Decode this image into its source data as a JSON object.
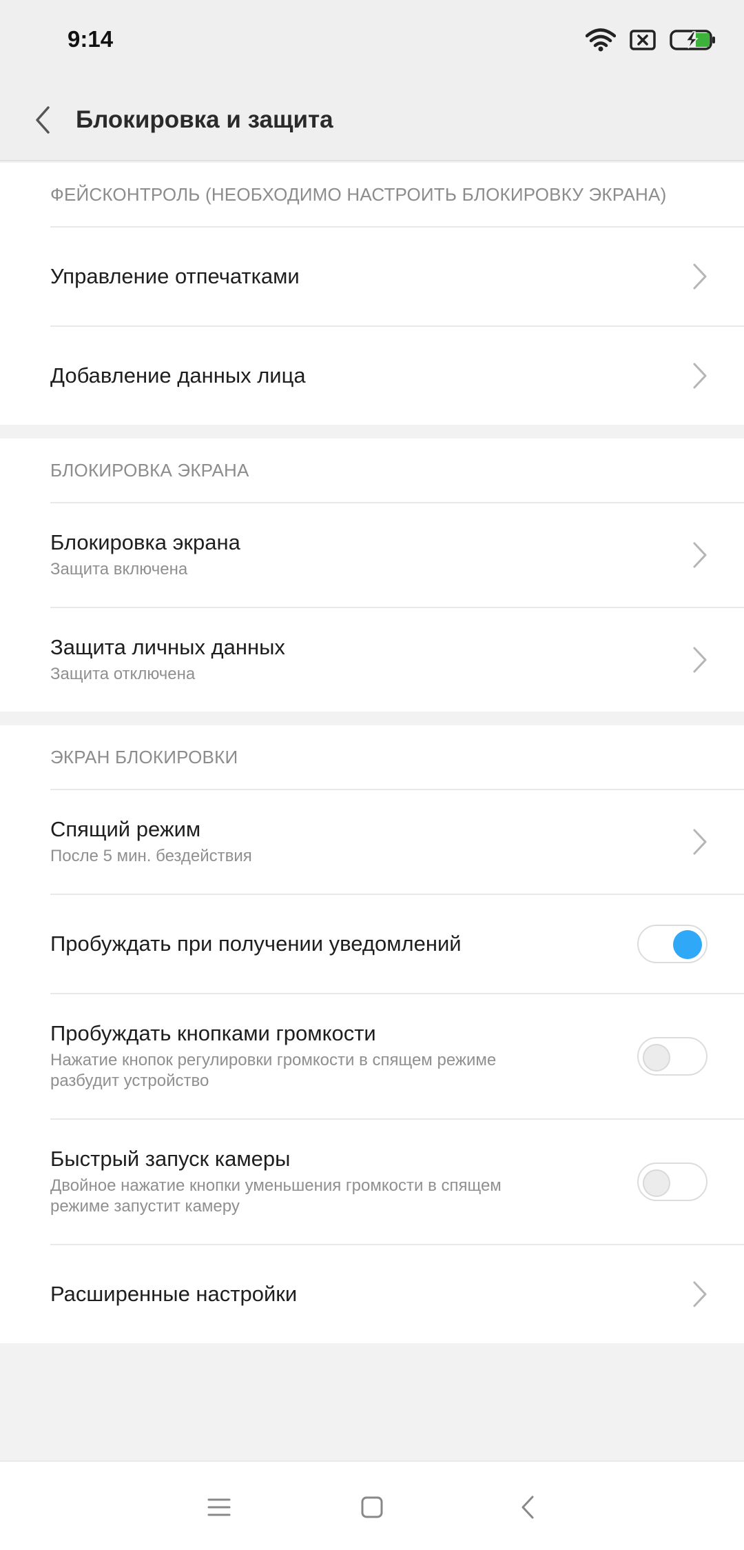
{
  "status": {
    "time": "9:14"
  },
  "header": {
    "title": "Блокировка и защита"
  },
  "colors": {
    "accent": "#2fa8f7",
    "battery": "#3db23a"
  },
  "sections": [
    {
      "header": "ФЕЙСКОНТРОЛЬ (НЕОБХОДИМО НАСТРОИТЬ БЛОКИРОВКУ ЭКРАНА)",
      "items": [
        {
          "title": "Управление отпечатками"
        },
        {
          "title": "Добавление данных лица"
        }
      ]
    },
    {
      "header": "БЛОКИРОВКА ЭКРАНА",
      "items": [
        {
          "title": "Блокировка экрана",
          "subtitle": "Защита включена"
        },
        {
          "title": "Защита личных данных",
          "subtitle": "Защита отключена"
        }
      ]
    },
    {
      "header": "ЭКРАН БЛОКИРОВКИ",
      "items": [
        {
          "title": "Спящий режим",
          "subtitle": "После 5 мин. бездействия"
        },
        {
          "title": "Пробуждать при получении уведомлений",
          "toggle": true
        },
        {
          "title": "Пробуждать кнопками громкости",
          "subtitle": "Нажатие кнопок регулировки громкости в спящем режиме разбудит устройство",
          "toggle": false
        },
        {
          "title": "Быстрый запуск камеры",
          "subtitle": "Двойное нажатие кнопки уменьшения громкости в спящем режиме запустит камеру",
          "toggle": false
        },
        {
          "title": "Расширенные настройки"
        }
      ]
    }
  ]
}
